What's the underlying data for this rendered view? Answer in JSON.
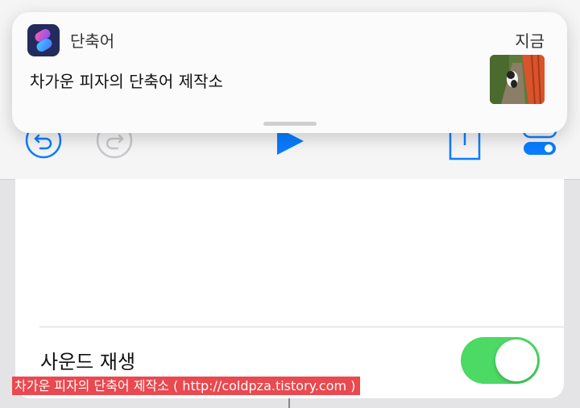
{
  "notification": {
    "app_name": "단축어",
    "time": "지금",
    "message": "차가운 피자의 단축어 제작소"
  },
  "toolbar": {
    "undo_icon": "undo-icon",
    "redo_icon": "redo-icon",
    "play_icon": "play-icon",
    "share_icon": "share-icon",
    "settings_icon": "settings-toggle-icon"
  },
  "settings": {
    "sound_label": "사운드 재생",
    "sound_enabled": true
  },
  "watermark": {
    "text": "차가운 피자의 단축어 제작소 ( http://coldpza.tistory.com )"
  },
  "colors": {
    "accent": "#0a7cff",
    "toggle_on": "#4cd964",
    "watermark_bg": "#e9494f"
  }
}
